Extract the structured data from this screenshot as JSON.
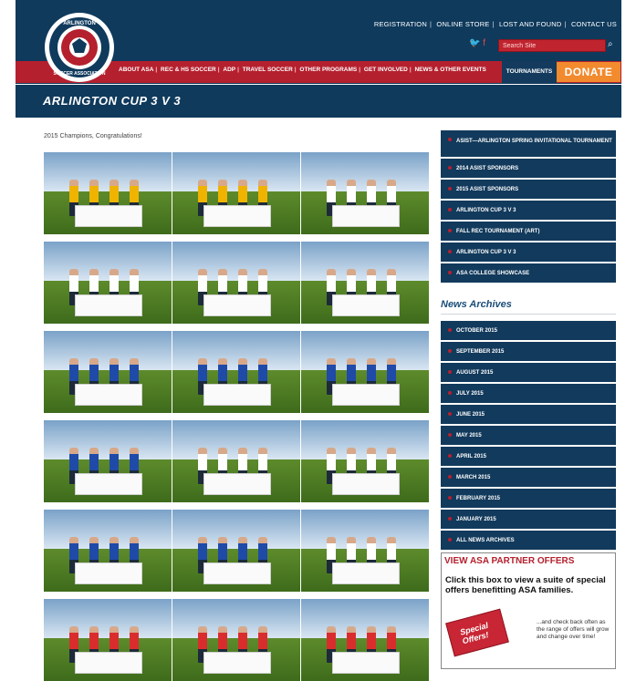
{
  "header": {
    "logo_text": "ARLINGTON SOCCER ASSOCIATION",
    "top_links": [
      "REGISTRATION",
      "ONLINE STORE",
      "LOST AND FOUND",
      "CONTACT US"
    ],
    "search_placeholder": "Search Site",
    "nav": [
      "ABOUT ASA",
      "REC & HS SOCCER",
      "ADP",
      "TRAVEL SOCCER",
      "OTHER PROGRAMS",
      "GET INVOLVED",
      "NEWS & OTHER EVENTS"
    ],
    "nav_active": "TOURNAMENTS",
    "donate": "DONATE",
    "icons": [
      "twitter-icon",
      "facebook-icon",
      "search-icon"
    ]
  },
  "page": {
    "title": "ARLINGTON CUP 3 V 3",
    "subtitle": "2015 Champions, Congratulations!"
  },
  "sidebar": {
    "items": [
      "ASIST—ARLINGTON SPRING INVITATIONAL TOURNAMENT",
      "2014 ASIST SPONSORS",
      "2015 ASIST SPONSORS",
      "ARLINGTON CUP 3 V 3",
      "FALL REC TOURNAMENT (ART)",
      "ARLINGTON CUP 3 V 3",
      "ASA COLLEGE SHOWCASE"
    ],
    "archives_title": "News Archives",
    "archives": [
      "OCTOBER 2015",
      "SEPTEMBER 2015",
      "AUGUST 2015",
      "JULY 2015",
      "JUNE 2015",
      "MAY 2015",
      "APRIL 2015",
      "MARCH 2015",
      "FEBRUARY 2015",
      "JANUARY 2015",
      "ALL NEWS ARCHIVES"
    ]
  },
  "partner": {
    "title": "VIEW ASA PARTNER OFFERS",
    "text": "Click this box to view a suite of special offers benefitting ASA families.",
    "tag": "Special Offers!",
    "small": "...and check back often as the range of offers will grow and change over time!"
  },
  "gallery": {
    "photos": [
      {
        "jersey": "#f0b400"
      },
      {
        "jersey": "#f0b400"
      },
      {
        "jersey": "#ffffff"
      },
      {
        "jersey": "#ffffff"
      },
      {
        "jersey": "#ffffff"
      },
      {
        "jersey": "#ffffff"
      },
      {
        "jersey": "#1f4aa8"
      },
      {
        "jersey": "#1f4aa8"
      },
      {
        "jersey": "#1f4aa8"
      },
      {
        "jersey": "#1f4aa8"
      },
      {
        "jersey": "#ffffff"
      },
      {
        "jersey": "#ffffff"
      },
      {
        "jersey": "#1f4aa8"
      },
      {
        "jersey": "#1f4aa8"
      },
      {
        "jersey": "#ffffff"
      },
      {
        "jersey": "#d92d2d"
      },
      {
        "jersey": "#d92d2d"
      },
      {
        "jersey": "#d92d2d"
      }
    ]
  }
}
